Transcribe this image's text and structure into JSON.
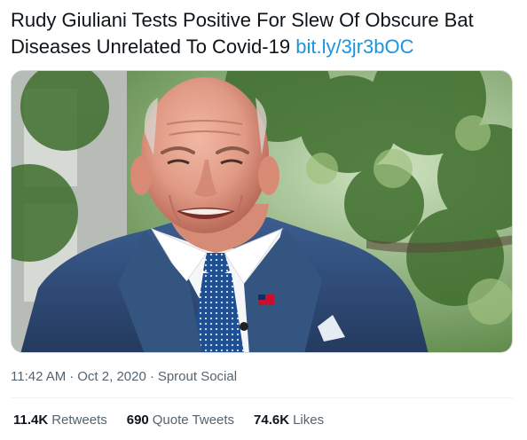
{
  "tweet": {
    "headline_line1": "Rudy Giuliani Tests Positive For Slew Of Obscure Bat",
    "headline_line2": "Diseases Unrelated To Covid-19",
    "link_text": "bit.ly/3jr3bOC"
  },
  "media": {
    "description_icon": "photo-icon"
  },
  "meta": {
    "time": "11:42 AM",
    "date": "Oct 2, 2020",
    "source": "Sprout Social",
    "separator": "·"
  },
  "stats": {
    "retweets_count": "11.4K",
    "retweets_label": "Retweets",
    "quotes_count": "690",
    "quotes_label": "Quote Tweets",
    "likes_count": "74.6K",
    "likes_label": "Likes"
  },
  "colors": {
    "link": "#1b95e0",
    "text": "#0f1419",
    "muted": "#536471"
  }
}
